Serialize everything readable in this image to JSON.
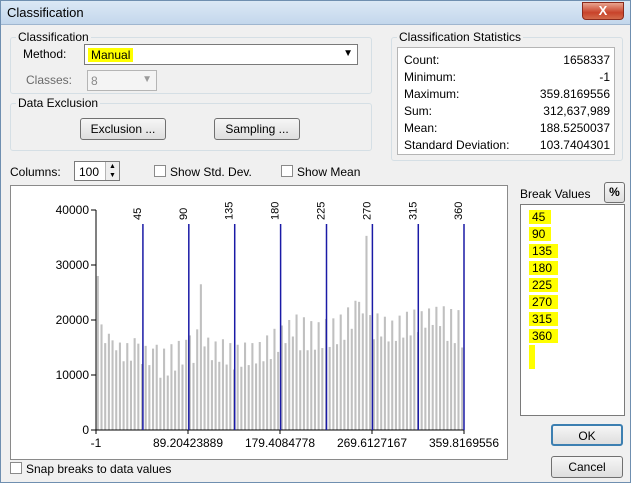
{
  "window": {
    "title": "Classification",
    "close_label": "X"
  },
  "classification": {
    "group_label": "Classification",
    "method_label": "Method:",
    "method_value": "Manual",
    "classes_label": "Classes:",
    "classes_value": "8"
  },
  "data_exclusion": {
    "group_label": "Data Exclusion",
    "exclusion_button": "Exclusion ...",
    "sampling_button": "Sampling ..."
  },
  "statistics": {
    "group_label": "Classification Statistics",
    "rows": [
      {
        "key": "Count:",
        "value": "1658337"
      },
      {
        "key": "Minimum:",
        "value": "-1"
      },
      {
        "key": "Maximum:",
        "value": "359.8169556"
      },
      {
        "key": "Sum:",
        "value": "312,637,989"
      },
      {
        "key": "Mean:",
        "value": "188.5250037"
      },
      {
        "key": "Standard Deviation:",
        "value": "103.7404301"
      }
    ]
  },
  "controls": {
    "columns_label": "Columns:",
    "columns_value": "100",
    "show_std_dev": "Show Std. Dev.",
    "show_mean": "Show Mean",
    "snap_breaks": "Snap breaks to data values"
  },
  "break_values": {
    "label": "Break Values",
    "percent_button": "%",
    "values": [
      "45",
      "90",
      "135",
      "180",
      "225",
      "270",
      "315",
      "360"
    ]
  },
  "buttons": {
    "ok": "OK",
    "cancel": "Cancel"
  },
  "colors": {
    "bar": "#c0c0c0",
    "break_line": "#1a1aa6",
    "highlight": "#ffff00"
  },
  "chart_data": {
    "type": "bar",
    "xlim": [
      -1,
      359.8169556
    ],
    "ylim": [
      0,
      40000
    ],
    "y_ticks": [
      0,
      10000,
      20000,
      30000,
      40000
    ],
    "x_tick_labels": [
      "-1",
      "89.20423889",
      "179.4084778",
      "269.6127167",
      "359.8169556"
    ],
    "x_tick_values": [
      -1,
      89.20423889,
      179.4084778,
      269.6127167,
      359.8169556
    ],
    "breaks": [
      45,
      90,
      135,
      180,
      225,
      270,
      315,
      360
    ],
    "bin_count": 100,
    "values": [
      28000,
      19200,
      15800,
      17500,
      16300,
      14500,
      15900,
      12500,
      15800,
      12600,
      16700,
      15700,
      12000,
      15300,
      11800,
      14800,
      15500,
      9500,
      14800,
      9900,
      15600,
      10800,
      16200,
      11900,
      16400,
      17200,
      12200,
      18300,
      26500,
      15200,
      16800,
      12700,
      16100,
      12400,
      16500,
      11900,
      15800,
      11000,
      15500,
      11500,
      15900,
      11800,
      15800,
      12100,
      16000,
      12500,
      17200,
      12900,
      18400,
      14200,
      19000,
      15800,
      20000,
      17000,
      21000,
      14500,
      20500,
      14500,
      19800,
      14600,
      19600,
      14900,
      20200,
      15100,
      20300,
      15600,
      21000,
      16400,
      22300,
      18400,
      23500,
      23300,
      21200,
      35300,
      20900,
      16500,
      21200,
      17000,
      20600,
      16100,
      19900,
      16200,
      20800,
      16800,
      21500,
      17200,
      21900,
      17800,
      21600,
      18600,
      22100,
      19100,
      22400,
      18900,
      22500,
      16200,
      22000,
      15800,
      21800,
      15000
    ]
  }
}
